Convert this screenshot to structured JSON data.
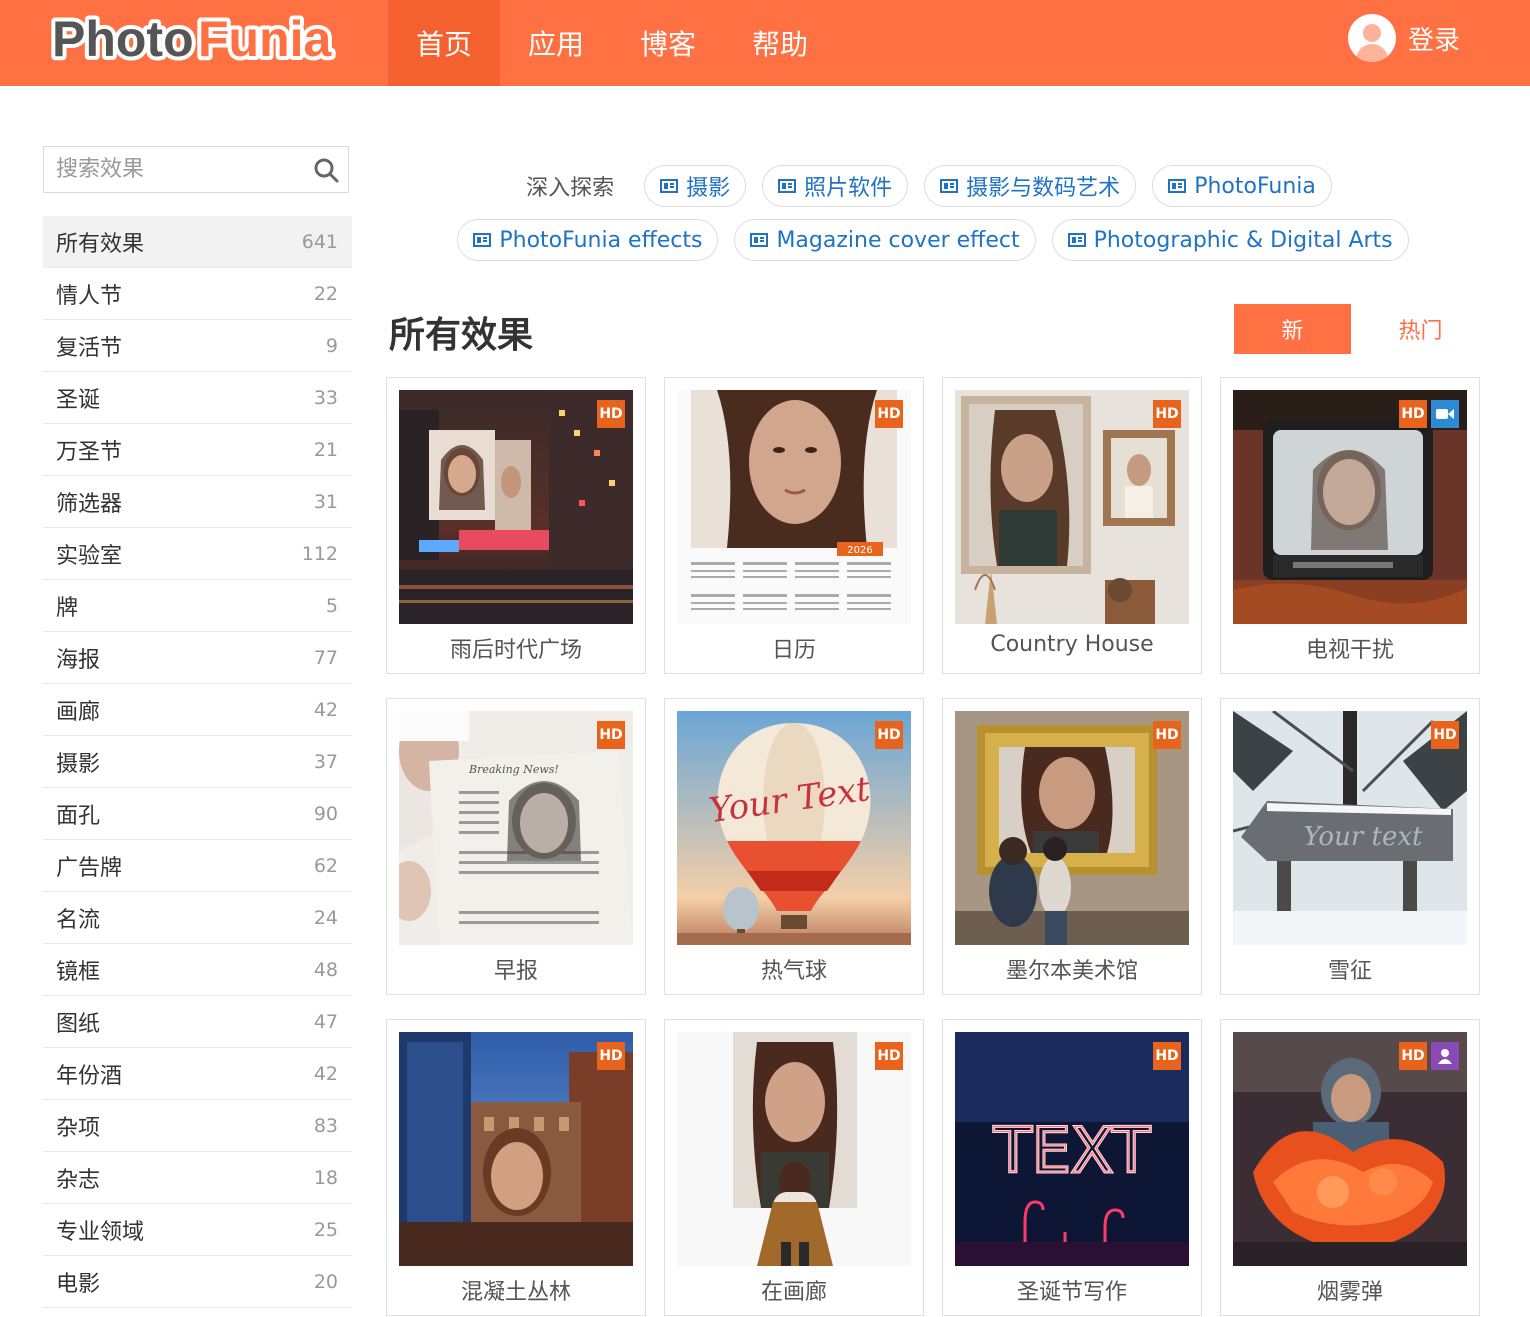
{
  "header": {
    "logo_text_1": "Photo",
    "logo_text_2": "Funia",
    "nav": [
      "首页",
      "应用",
      "博客",
      "帮助"
    ],
    "login_label": "登录",
    "brand_color": "#ff7043"
  },
  "sidebar": {
    "search_placeholder": "搜索效果",
    "categories": [
      {
        "label": "所有效果",
        "count": "641"
      },
      {
        "label": "情人节",
        "count": "22"
      },
      {
        "label": "复活节",
        "count": "9"
      },
      {
        "label": "圣诞",
        "count": "33"
      },
      {
        "label": "万圣节",
        "count": "21"
      },
      {
        "label": "筛选器",
        "count": "31"
      },
      {
        "label": "实验室",
        "count": "112"
      },
      {
        "label": "牌",
        "count": "5"
      },
      {
        "label": "海报",
        "count": "77"
      },
      {
        "label": "画廊",
        "count": "42"
      },
      {
        "label": "摄影",
        "count": "37"
      },
      {
        "label": "面孔",
        "count": "90"
      },
      {
        "label": "广告牌",
        "count": "62"
      },
      {
        "label": "名流",
        "count": "24"
      },
      {
        "label": "镜框",
        "count": "48"
      },
      {
        "label": "图纸",
        "count": "47"
      },
      {
        "label": "年份酒",
        "count": "42"
      },
      {
        "label": "杂项",
        "count": "83"
      },
      {
        "label": "杂志",
        "count": "18"
      },
      {
        "label": "专业领域",
        "count": "25"
      },
      {
        "label": "电影",
        "count": "20"
      }
    ]
  },
  "explore": {
    "label": "深入探索",
    "tags_row1": [
      "摄影",
      "照片软件",
      "摄影与数码艺术",
      "PhotoFunia"
    ],
    "tags_row2": [
      "PhotoFunia effects",
      "Magazine cover effect",
      "Photographic & Digital Arts"
    ]
  },
  "main": {
    "title": "所有效果",
    "sort_new": "新",
    "sort_hot": "热门",
    "hd_label": "HD",
    "calendar_year": "2026",
    "balloon_text": "Your Text",
    "sign_text": "Your text",
    "neon_text": "TEXT",
    "effects": [
      {
        "title": "雨后时代广场",
        "icon": "photo-times-square"
      },
      {
        "title": "日历",
        "icon": "photo-calendar"
      },
      {
        "title": "Country House",
        "icon": "photo-country-house"
      },
      {
        "title": "电视干扰",
        "icon": "photo-tv-interference",
        "video": true
      },
      {
        "title": "早报",
        "icon": "photo-newspaper"
      },
      {
        "title": "热气球",
        "icon": "photo-hot-air-balloon"
      },
      {
        "title": "墨尔本美术馆",
        "icon": "photo-melbourne-gallery"
      },
      {
        "title": "雪征",
        "icon": "photo-snow-sign"
      },
      {
        "title": "混凝土丛林",
        "icon": "photo-concrete-jungle"
      },
      {
        "title": "在画廊",
        "icon": "photo-in-gallery"
      },
      {
        "title": "圣诞节写作",
        "icon": "photo-christmas-writing"
      },
      {
        "title": "烟雾弹",
        "icon": "photo-smoke-bomb",
        "user": true
      }
    ]
  }
}
